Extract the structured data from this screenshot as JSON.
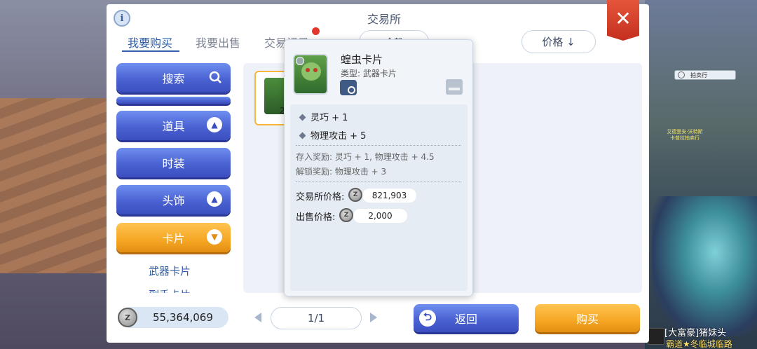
{
  "header": {
    "title": "交易所",
    "info_glyph": "i",
    "close_glyph": "✕",
    "tabs": [
      {
        "label": "我要购买",
        "active": true
      },
      {
        "label": "我要出售",
        "active": false
      },
      {
        "label": "交易记录",
        "active": false
      }
    ],
    "filter_label": "全部",
    "sort_label": "价格 ↓"
  },
  "sidebar": {
    "search_label": "搜索",
    "categories": [
      {
        "label": "道具",
        "expanded": false
      },
      {
        "label": "时装"
      },
      {
        "label": "头饰",
        "expanded": false
      },
      {
        "label": "卡片",
        "expanded": true,
        "selected": true
      }
    ],
    "sub_items": [
      "武器卡片",
      "副手卡片"
    ]
  },
  "footer": {
    "zeny": "55,364,069",
    "zeny_icon": "Z",
    "page": "1/1",
    "back_label": "返回",
    "buy_label": "购买"
  },
  "item_slot": {
    "count": "2"
  },
  "popup": {
    "name": "蝗虫卡片",
    "type": "类型: 武器卡片",
    "stats": [
      "灵巧 + 1",
      "物理攻击 + 5"
    ],
    "deposit_bonus": "存入奖励: 灵巧 + 1, 物理攻击 + 4.5",
    "unlock_bonus": "解锁奖励: 物理攻击 + 3",
    "exchange_price_label": "交易所价格:",
    "exchange_price": "821,903",
    "sell_price_label": "出售价格:",
    "sell_price": "2,000"
  },
  "world": {
    "npc_tag": "拍卖行",
    "npc_name": "艾德里安·沃特斯 卡普拉拍卖行",
    "player_name": "[大富豪]猪妹头",
    "guild_name": "霸道★冬临城临路"
  },
  "colors": {
    "accent_blue": "#2e5fa8",
    "accent_orange": "#f5a623",
    "close_red": "#d63b27"
  }
}
